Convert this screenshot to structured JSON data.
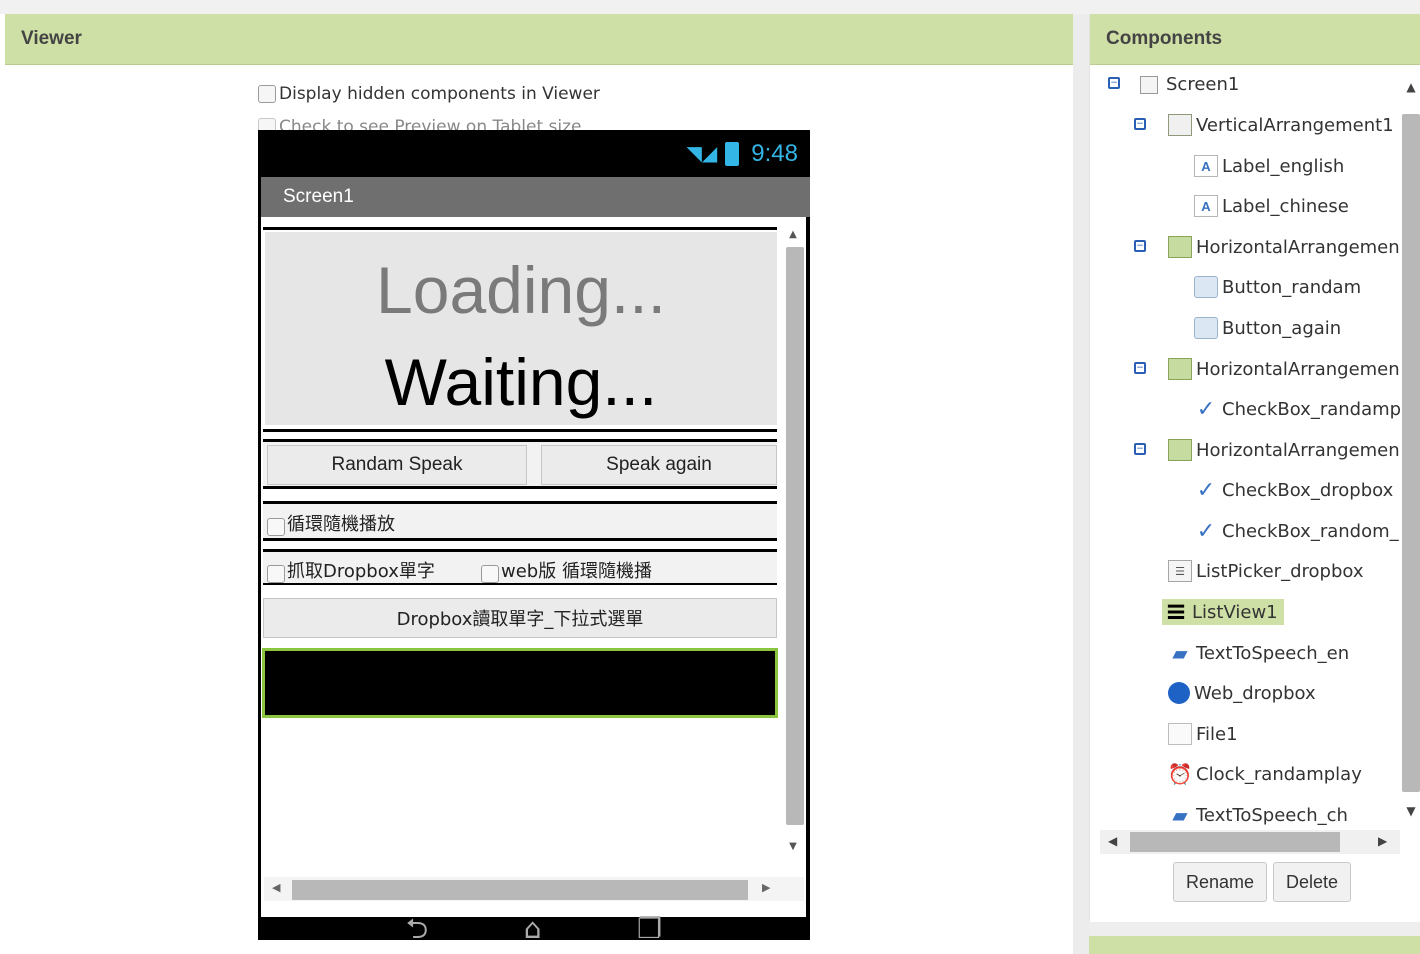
{
  "viewer": {
    "title": "Viewer",
    "opt_hidden": "Display hidden components in Viewer",
    "opt_tablet": "Check to see Preview on Tablet size."
  },
  "phone": {
    "time": "9:48",
    "screen_title": "Screen1",
    "loading": "Loading...",
    "waiting": "Waiting...",
    "btn_random": "Randam Speak",
    "btn_again": "Speak again",
    "cb_loop": "循環隨機播放",
    "cb_dropbox": "抓取Dropbox單字",
    "cb_web": "web版 循環隨機播",
    "listpicker": "Dropbox讀取單字_下拉式選單"
  },
  "components": {
    "title": "Components",
    "tree": [
      {
        "label": "Screen1",
        "icon": "screen-icon"
      },
      {
        "label": "VerticalArrangement1",
        "icon": "vertical-arrangement-icon"
      },
      {
        "label": "Label_english",
        "icon": "label-icon"
      },
      {
        "label": "Label_chinese",
        "icon": "label-icon"
      },
      {
        "label": "HorizontalArrangemen",
        "icon": "horizontal-arrangement-icon"
      },
      {
        "label": "Button_randam",
        "icon": "button-icon"
      },
      {
        "label": "Button_again",
        "icon": "button-icon"
      },
      {
        "label": "HorizontalArrangemen",
        "icon": "horizontal-arrangement-icon"
      },
      {
        "label": "CheckBox_randamp",
        "icon": "checkbox-icon"
      },
      {
        "label": "HorizontalArrangemen",
        "icon": "horizontal-arrangement-icon"
      },
      {
        "label": "CheckBox_dropbox",
        "icon": "checkbox-icon"
      },
      {
        "label": "CheckBox_random_",
        "icon": "checkbox-icon"
      },
      {
        "label": "ListPicker_dropbox",
        "icon": "listpicker-icon"
      },
      {
        "label": "ListView1",
        "icon": "listview-icon"
      },
      {
        "label": "TextToSpeech_en",
        "icon": "texttospeech-icon"
      },
      {
        "label": "Web_dropbox",
        "icon": "web-icon"
      },
      {
        "label": "File1",
        "icon": "file-icon"
      },
      {
        "label": "Clock_randamplay",
        "icon": "clock-icon"
      },
      {
        "label": "TextToSpeech_ch",
        "icon": "texttospeech-icon"
      }
    ],
    "rename": "Rename",
    "delete": "Delete"
  }
}
